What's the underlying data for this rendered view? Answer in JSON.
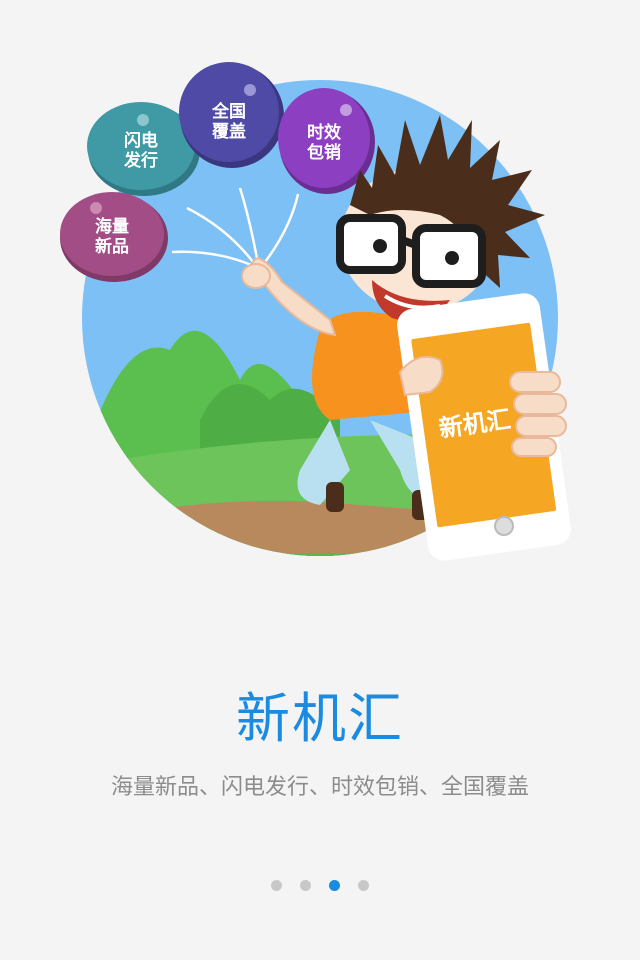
{
  "illustration": {
    "balloons": [
      {
        "text_line1": "海量",
        "text_line2": "新品",
        "color": "#a34d86"
      },
      {
        "text_line1": "闪电",
        "text_line2": "发行",
        "color": "#3f9aa6"
      },
      {
        "text_line1": "全国",
        "text_line2": "覆盖",
        "color": "#4f4aa6"
      },
      {
        "text_line1": "时效",
        "text_line2": "包销",
        "color": "#8c3fc0"
      }
    ],
    "phone_text": "新机汇",
    "phone_screen_color": "#f5a623",
    "sky_color": "#7cc0f5",
    "hill_color": "#5bbf50"
  },
  "intro": {
    "title": "新机汇",
    "subtitle": "海量新品、闪电发行、时效包销、全国覆盖"
  },
  "pager": {
    "total": 4,
    "active_index": 2,
    "active_color": "#1a8be0",
    "inactive_color": "#c8c8c8"
  }
}
